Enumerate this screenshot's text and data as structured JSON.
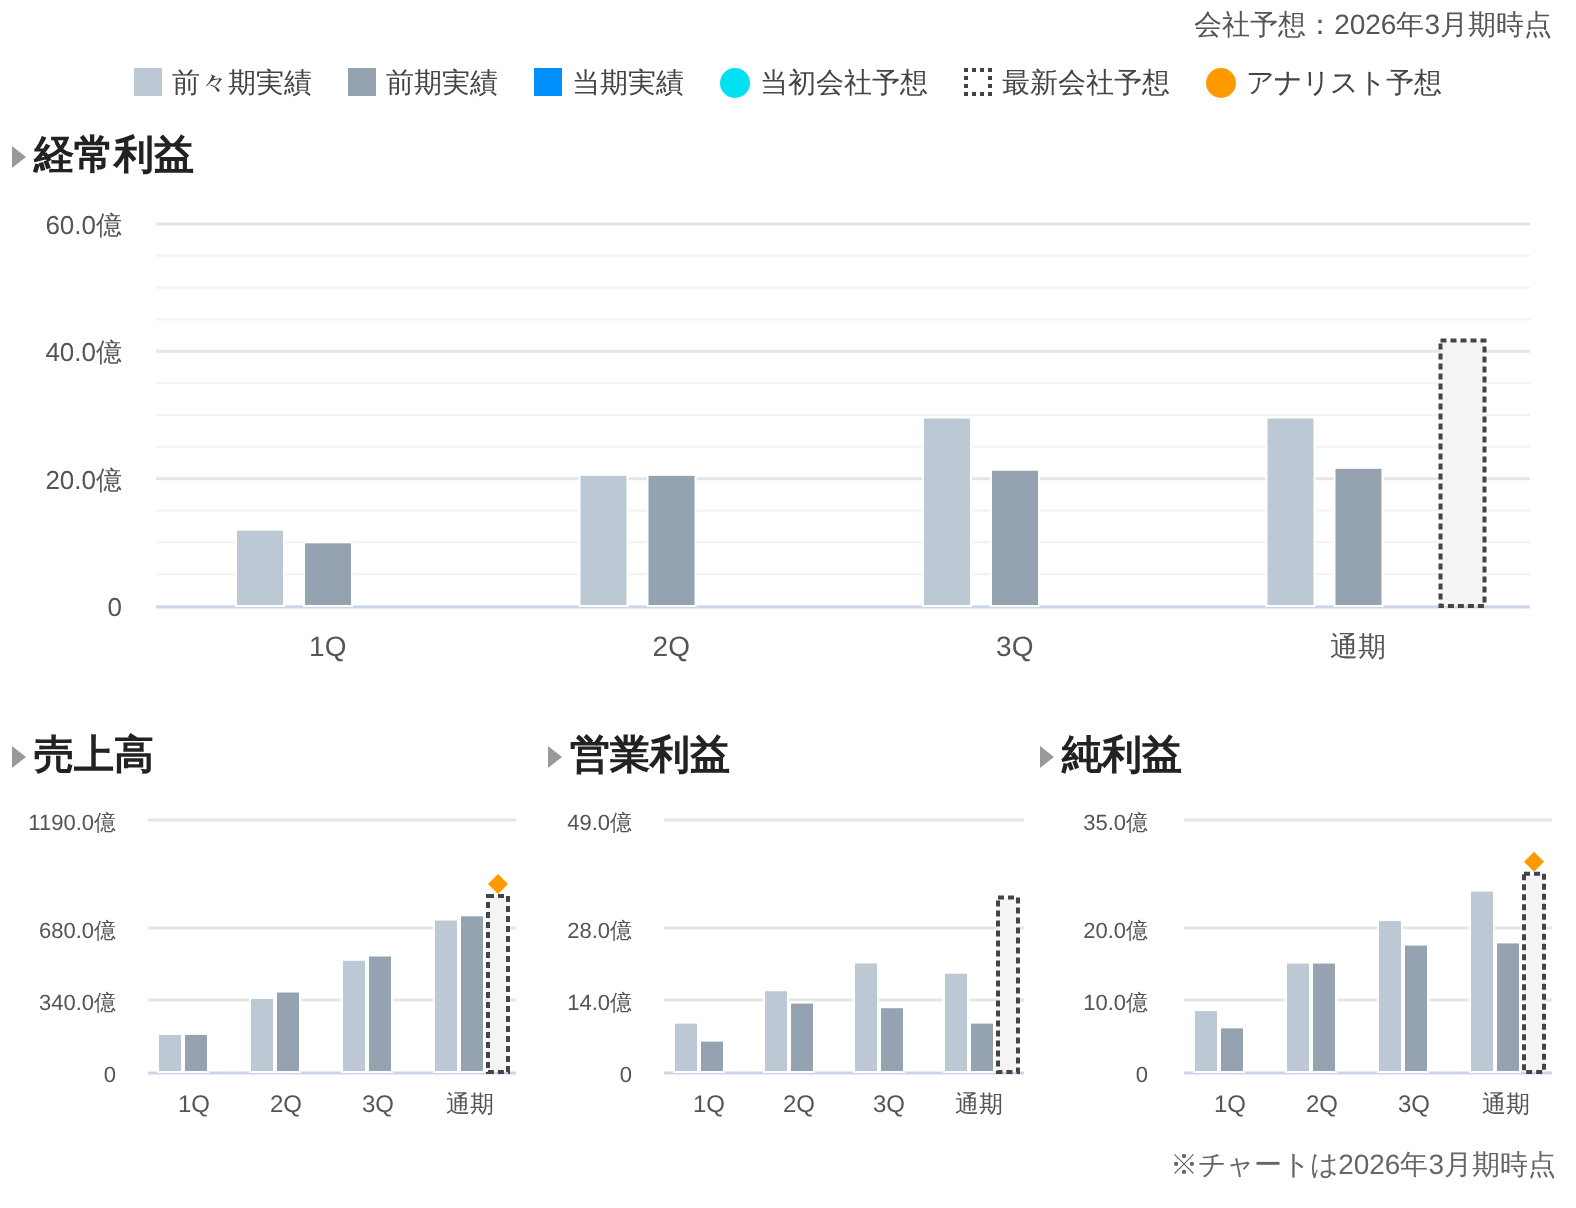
{
  "note": "会社予想：2026年3月期時点",
  "legend": [
    {
      "label": "前々期実績",
      "kind": "square",
      "color": "#bcc9d4"
    },
    {
      "label": "前期実績",
      "kind": "square",
      "color": "#94a3af"
    },
    {
      "label": "当期実績",
      "kind": "square",
      "color": "#0091ff"
    },
    {
      "label": "当初会社予想",
      "kind": "circle",
      "color": "#00e0f0"
    },
    {
      "label": "最新会社予想",
      "kind": "dotted",
      "color": "#444444"
    },
    {
      "label": "アナリスト予想",
      "kind": "circle",
      "color": "#ff9900"
    }
  ],
  "main": {
    "title": "経常利益",
    "chart_data": {
      "type": "bar",
      "categories": [
        "1Q",
        "2Q",
        "3Q",
        "通期"
      ],
      "ylim": [
        0,
        60
      ],
      "yticks": [
        {
          "value": 0,
          "label": "0"
        },
        {
          "value": 20,
          "label": "20.0億"
        },
        {
          "value": 40,
          "label": "40.0億"
        },
        {
          "value": 60,
          "label": "60.0億"
        }
      ],
      "series": [
        {
          "color": "#bcc9d4",
          "values": [
            12.0,
            20.6,
            29.6,
            29.6
          ]
        },
        {
          "color": "#94a3af",
          "values": [
            10.0,
            20.6,
            21.4,
            21.7
          ]
        },
        {
          "color": "#444444",
          "values": [
            null,
            null,
            null,
            42.0
          ]
        }
      ]
    }
  },
  "sections": [
    {
      "title": "売上高",
      "chart_data": {
        "type": "bar",
        "categories": [
          "1Q",
          "2Q",
          "3Q",
          "通期"
        ],
        "ylim": [
          0,
          1190
        ],
        "yticks": [
          {
            "value": 0,
            "label": "0"
          },
          {
            "value": 340,
            "label": "340.0億"
          },
          {
            "value": 680,
            "label": "680.0億"
          },
          {
            "value": 1190,
            "label": "1190.0億"
          }
        ],
        "series": [
          {
            "color": "#bcc9d4",
            "values": [
              180,
              350,
              530,
              720
            ]
          },
          {
            "color": "#94a3af",
            "values": [
              180,
              380,
              550,
              740
            ]
          },
          {
            "color": "#444444",
            "values": [
              null,
              null,
              null,
              840
            ]
          }
        ]
      },
      "analyst_marker": true
    },
    {
      "title": "営業利益",
      "chart_data": {
        "type": "bar",
        "categories": [
          "1Q",
          "2Q",
          "3Q",
          "通期"
        ],
        "ylim": [
          0,
          49
        ],
        "yticks": [
          {
            "value": 0,
            "label": "0"
          },
          {
            "value": 14,
            "label": "14.0億"
          },
          {
            "value": 28,
            "label": "28.0億"
          },
          {
            "value": 49,
            "label": "49.0億"
          }
        ],
        "series": [
          {
            "color": "#bcc9d4",
            "values": [
              9.6,
              15.9,
              21.3,
              19.3
            ]
          },
          {
            "color": "#94a3af",
            "values": [
              6.1,
              13.5,
              12.6,
              9.6
            ]
          },
          {
            "color": "#444444",
            "values": [
              null,
              null,
              null,
              34.3
            ]
          }
        ]
      },
      "analyst_marker": false
    },
    {
      "title": "純利益",
      "chart_data": {
        "type": "bar",
        "categories": [
          "1Q",
          "2Q",
          "3Q",
          "通期"
        ],
        "ylim": [
          0,
          35
        ],
        "yticks": [
          {
            "value": 0,
            "label": "0"
          },
          {
            "value": 10,
            "label": "10.0億"
          },
          {
            "value": 20,
            "label": "20.0億"
          },
          {
            "value": 35,
            "label": "35.0億"
          }
        ],
        "series": [
          {
            "color": "#bcc9d4",
            "values": [
              8.6,
              15.2,
              21.1,
              25.2
            ]
          },
          {
            "color": "#94a3af",
            "values": [
              6.2,
              15.2,
              17.7,
              18.0
            ]
          },
          {
            "color": "#444444",
            "values": [
              null,
              null,
              null,
              27.8
            ]
          }
        ]
      },
      "analyst_marker": true
    }
  ],
  "footnote": "※チャートは2026年3月期時点"
}
